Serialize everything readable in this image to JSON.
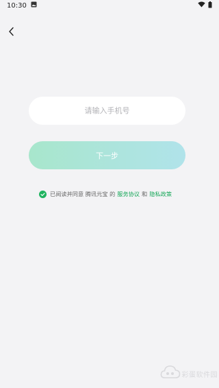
{
  "status_bar": {
    "time": "10:30"
  },
  "icons": {
    "back": "chevron-left-icon",
    "image": "image-icon",
    "wifi": "wifi-icon",
    "battery": "battery-icon",
    "check": "check-circle-icon",
    "watermark": "cloud-logo-icon"
  },
  "login": {
    "phone_placeholder": "请输入手机号",
    "phone_value": "",
    "next_label": "下一步"
  },
  "agreement": {
    "prefix": "已阅读并同意 腾讯元宝 的",
    "service_link": "服务协议",
    "conjunction": "和",
    "privacy_link": "隐私政策"
  },
  "watermark": {
    "text": "彩蛋软件园"
  },
  "colors": {
    "background": "#f3f3f5",
    "accent": "#1aa85b",
    "button_gradient_start": "#a8e6cc",
    "button_gradient_end": "#b0e3ea"
  }
}
